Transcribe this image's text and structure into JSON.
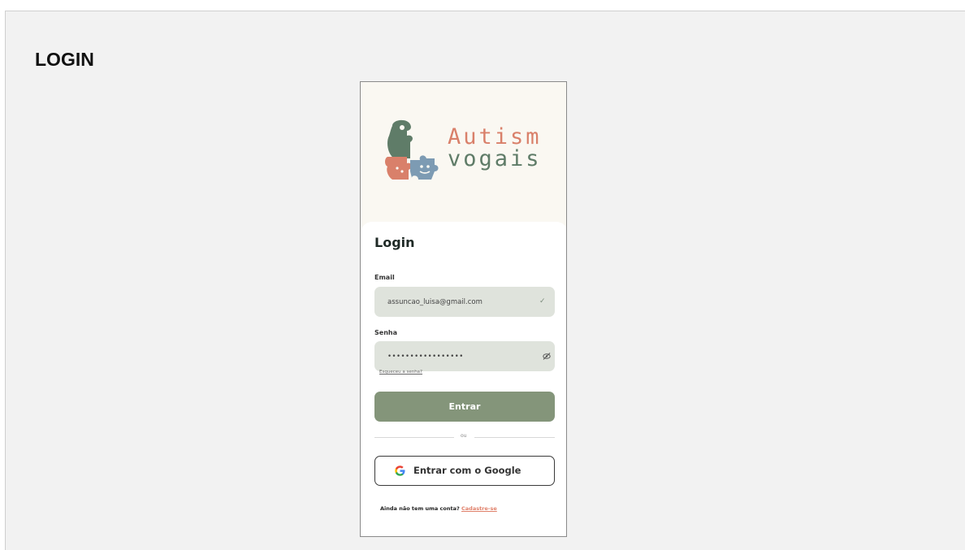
{
  "page": {
    "heading": "LOGIN"
  },
  "brand": {
    "line1": "Autism",
    "line2": "vogais"
  },
  "form": {
    "title": "Login",
    "email_label": "Email",
    "email_value": "assuncao_luisa@gmail.com",
    "password_label": "Senha",
    "password_value": "•••••••••••••••••",
    "forgot_link": "Esqueceu a senha?",
    "submit_label": "Entrar",
    "divider_text": "ou",
    "google_label": "Entrar com o Google",
    "signup_prompt": "Ainda não tem uma conta?",
    "signup_link": "Cadastre-se"
  },
  "icons": {
    "email_status": "check-icon",
    "password_toggle": "eye-off-icon",
    "google": "google-icon"
  },
  "colors": {
    "primary_button": "#84957a",
    "accent": "#e0806a",
    "input_bg": "#dfe3dc",
    "brand_green": "#5f7c68",
    "brand_orange": "#d9806a",
    "brand_blue": "#7d9bb3"
  }
}
